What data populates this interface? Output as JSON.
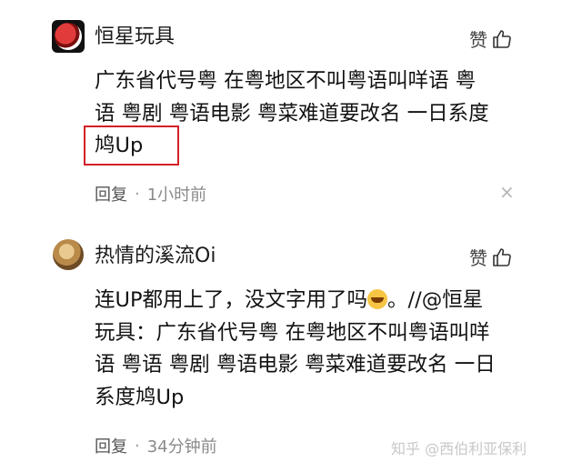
{
  "comments": [
    {
      "author": "恒星玩具",
      "like_label": "赞",
      "content": "广东省代号粤 在粤地区不叫粤语叫咩语 粤\n语 粤剧 粤语电影 粤菜难道要改名 一日系度\n鸠Up",
      "reply_label": "回复",
      "separator": "·",
      "time": "1小时前",
      "close_glyph": "×"
    },
    {
      "author": "热情的溪流Oi",
      "like_label": "赞",
      "content_before_emoji": "连UP都用上了，没文字用了吗",
      "content_after_emoji": "。//@恒星\n玩具：广东省代号粤 在粤地区不叫粤语叫咩\n语 粤语 粤剧 粤语电影 粤菜难道要改名 一日\n系度鸠Up",
      "reply_label": "回复",
      "separator": "·",
      "time": "34分钟前"
    }
  ],
  "highlight_color": "#d32027",
  "watermark": "知乎 @西伯利亚保利"
}
